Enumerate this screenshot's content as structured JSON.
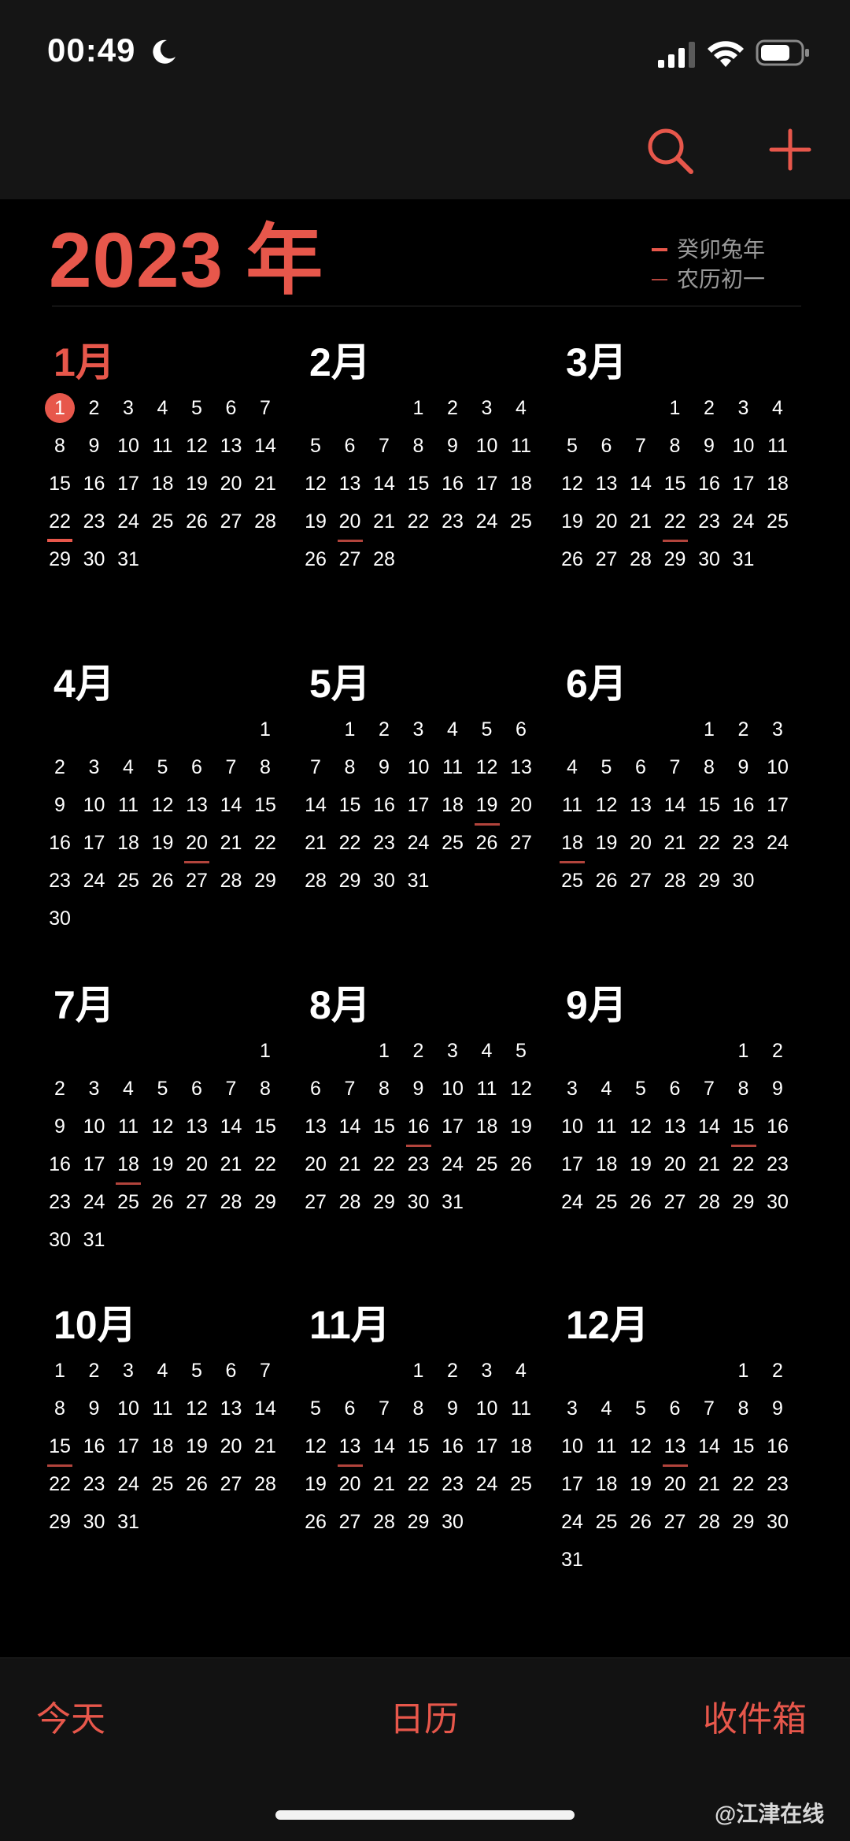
{
  "status_bar": {
    "time": "00:49",
    "icons": [
      "moon-icon",
      "signal-icon",
      "wifi-icon",
      "battery-icon"
    ]
  },
  "nav": {
    "icons": [
      "search-icon",
      "plus-icon"
    ]
  },
  "header": {
    "year_title": "2023 年",
    "legend": [
      {
        "label": "癸卯兔年"
      },
      {
        "label": "农历初一"
      }
    ]
  },
  "colors": {
    "accent": "#e7574b",
    "background": "#000000",
    "bar_background": "#151515",
    "muted_text": "#9a9a9a"
  },
  "calendar": {
    "year": 2023,
    "today_month": 1,
    "today_day": 1,
    "months": [
      {
        "title": "1月",
        "first_weekday": 0,
        "days": 31,
        "lunar_new_month_day": 22,
        "current": true
      },
      {
        "title": "2月",
        "first_weekday": 3,
        "days": 28,
        "lunar_new_month_day": 20
      },
      {
        "title": "3月",
        "first_weekday": 3,
        "days": 31,
        "lunar_new_month_day": 22
      },
      {
        "title": "4月",
        "first_weekday": 6,
        "days": 30,
        "lunar_new_month_day": 20
      },
      {
        "title": "5月",
        "first_weekday": 1,
        "days": 31,
        "lunar_new_month_day": 19
      },
      {
        "title": "6月",
        "first_weekday": 4,
        "days": 30,
        "lunar_new_month_day": 18
      },
      {
        "title": "7月",
        "first_weekday": 6,
        "days": 31,
        "lunar_new_month_day": 18
      },
      {
        "title": "8月",
        "first_weekday": 2,
        "days": 31,
        "lunar_new_month_day": 16
      },
      {
        "title": "9月",
        "first_weekday": 5,
        "days": 30,
        "lunar_new_month_day": 15
      },
      {
        "title": "10月",
        "first_weekday": 0,
        "days": 31,
        "lunar_new_month_day": 15
      },
      {
        "title": "11月",
        "first_weekday": 3,
        "days": 30,
        "lunar_new_month_day": 13
      },
      {
        "title": "12月",
        "first_weekday": 5,
        "days": 31,
        "lunar_new_month_day": 13
      }
    ]
  },
  "tabbar": {
    "today": "今天",
    "calendars": "日历",
    "inbox": "收件箱"
  },
  "watermark": "@江津在线"
}
